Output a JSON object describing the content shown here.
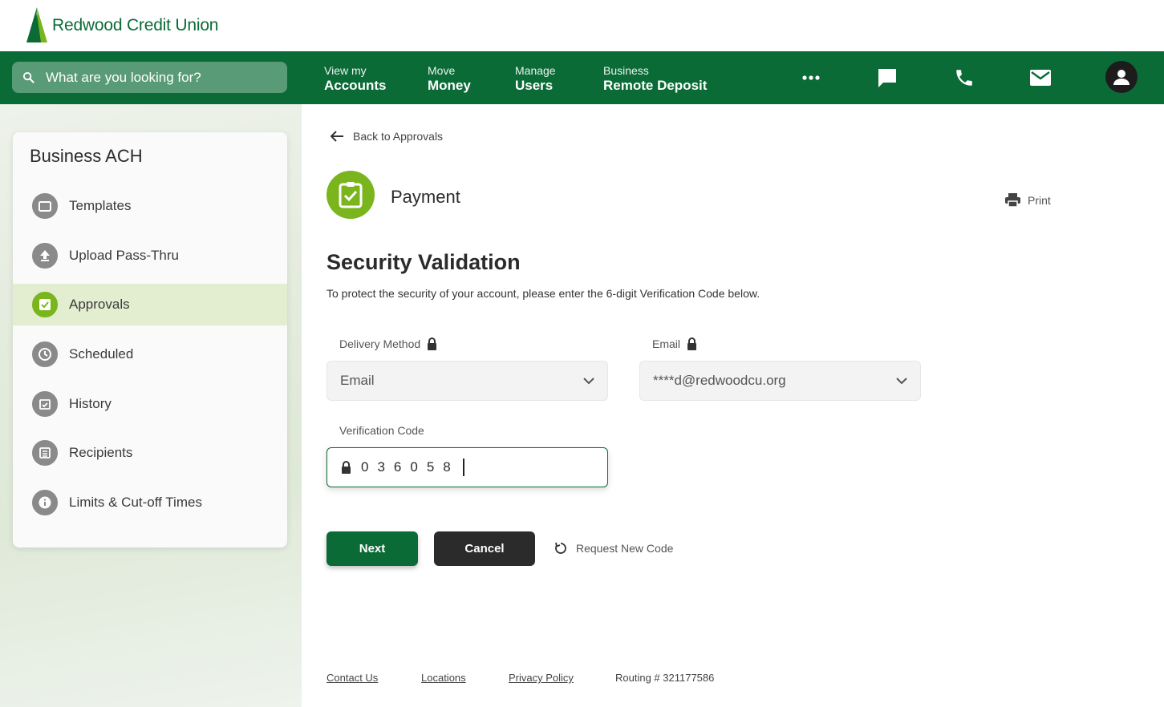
{
  "brand": {
    "name": "Redwood Credit Union",
    "color": "#0b6b37"
  },
  "search": {
    "placeholder": "What are you looking for?"
  },
  "nav": [
    {
      "small": "View my",
      "big": "Accounts"
    },
    {
      "small": "Move",
      "big": "Money"
    },
    {
      "small": "Manage",
      "big": "Users"
    },
    {
      "small": "Business",
      "big": "Remote Deposit"
    }
  ],
  "nav_icons": [
    "more-icon",
    "chat-icon",
    "phone-icon",
    "mail-icon",
    "account-avatar"
  ],
  "sidebar": {
    "title": "Business ACH",
    "items": [
      {
        "label": "Templates",
        "icon": "folder-icon"
      },
      {
        "label": "Upload Pass-Thru",
        "icon": "upload-icon"
      },
      {
        "label": "Approvals",
        "icon": "approval-check-icon",
        "active": true
      },
      {
        "label": "Scheduled",
        "icon": "clock-icon"
      },
      {
        "label": "History",
        "icon": "calendar-check-icon"
      },
      {
        "label": "Recipients",
        "icon": "list-icon"
      },
      {
        "label": "Limits & Cut-off Times",
        "icon": "info-icon"
      }
    ]
  },
  "main": {
    "back_label": "Back to Approvals",
    "page_title": "Payment",
    "print_label": "Print",
    "section_title": "Security Validation",
    "section_desc": "To protect the security of your account, please enter the 6-digit Verification Code below.",
    "delivery_label": "Delivery Method",
    "delivery_value": "Email",
    "email_label": "Email",
    "email_value": "****d@redwoodcu.org",
    "code_label": "Verification Code",
    "code_value": "036058",
    "next_label": "Next",
    "cancel_label": "Cancel",
    "request_label": "Request New Code"
  },
  "footer": {
    "contact": "Contact Us",
    "locations": "Locations",
    "privacy": "Privacy Policy",
    "routing": "Routing # 321177586"
  }
}
